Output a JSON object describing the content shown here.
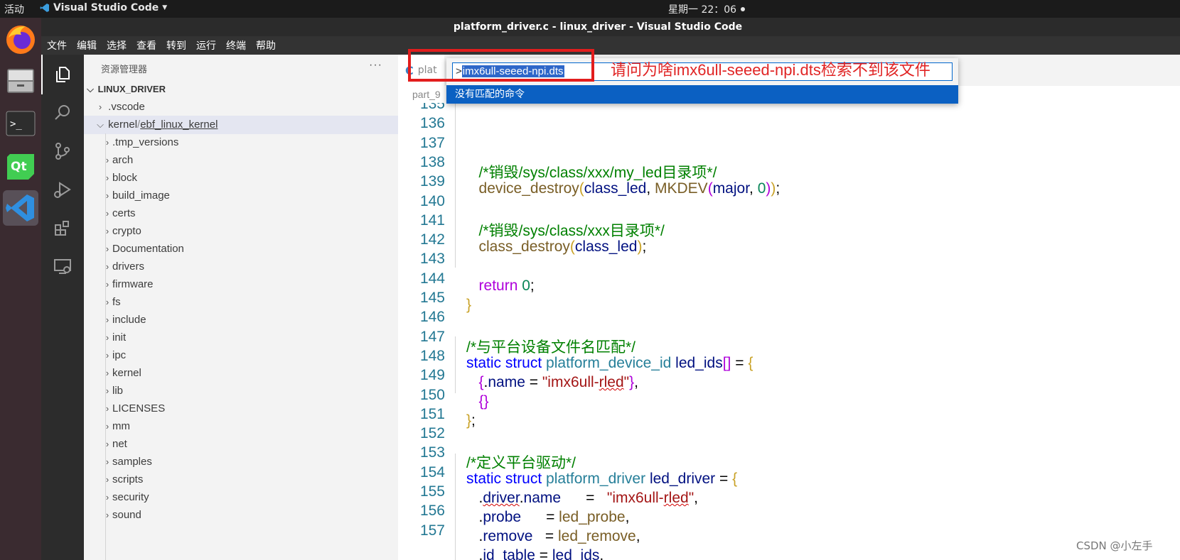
{
  "system": {
    "activities": "活动",
    "app_name": "Visual Studio Code",
    "clock": "星期一 22：06"
  },
  "window": {
    "title": "platform_driver.c - linux_driver - Visual Studio Code"
  },
  "menu": [
    "文件",
    "编辑",
    "选择",
    "查看",
    "转到",
    "运行",
    "终端",
    "帮助"
  ],
  "explorer": {
    "header": "资源管理器",
    "more": "···",
    "root": "LINUX_DRIVER",
    "vscode": ".vscode",
    "kernel_prefix": "kernel",
    "kernel_sep": "/",
    "kernel_name": "ebf_linux_kernel",
    "folders": [
      ".tmp_versions",
      "arch",
      "block",
      "build_image",
      "certs",
      "crypto",
      "Documentation",
      "drivers",
      "firmware",
      "fs",
      "include",
      "init",
      "ipc",
      "kernel",
      "lib",
      "LICENSES",
      "mm",
      "net",
      "samples",
      "scripts",
      "security",
      "sound"
    ]
  },
  "editor": {
    "tab_icon": "C",
    "tab_label": "plat",
    "breadcrumb": "part_9",
    "line_numbers": [
      "135",
      "136",
      "137",
      "138",
      "139",
      "140",
      "141",
      "142",
      "143",
      "144",
      "145",
      "146",
      "147",
      "148",
      "149",
      "150",
      "151",
      "152",
      "153",
      "154",
      "155",
      "156",
      "157"
    ]
  },
  "palette": {
    "prefix": ">",
    "value": "imx6ull-seeed-npi.dts",
    "annotation": "请问为啥imx6ull-seeed-npi.dts检索不到该文件",
    "result": "没有匹配的命令"
  },
  "watermark": "CSDN @小左手",
  "colors": {
    "highlight_box": "#e21d1d",
    "palette_selection": "#0b60c2",
    "annotation_text": "#e02424"
  }
}
